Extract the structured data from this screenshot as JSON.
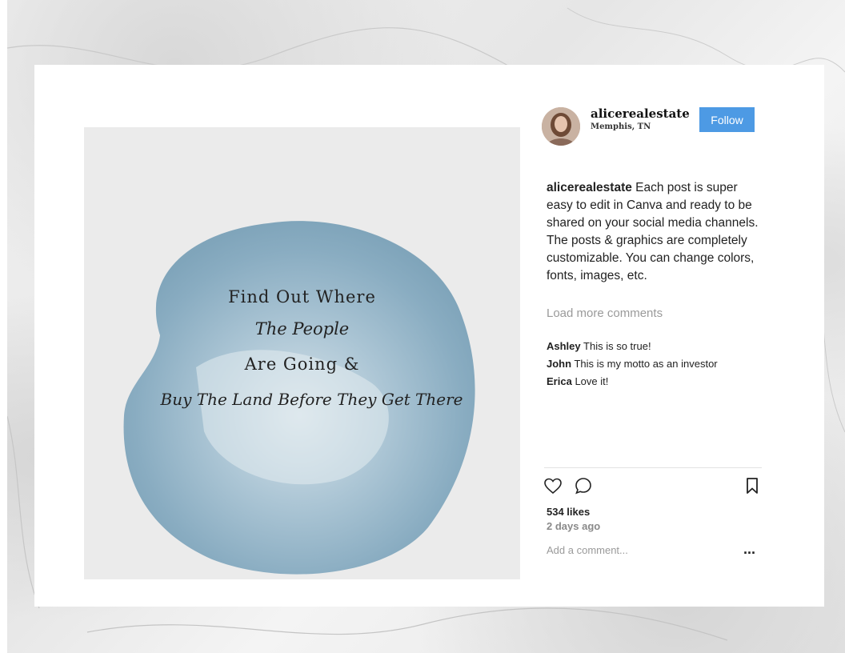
{
  "post": {
    "quote": {
      "line1": "Find Out Where",
      "line2": "The People",
      "line3": "Are Going &",
      "line4": "Buy The  Land Before They Get There"
    }
  },
  "profile": {
    "username": "alicerealestate",
    "location": "Memphis, TN",
    "follow_label": "Follow"
  },
  "caption": {
    "username": "alicerealestate",
    "text": "Each post is super easy to edit in Canva and ready to be shared on your social media channels. The posts & graphics are completely customizable. You can change colors, fonts, images, etc."
  },
  "comments": {
    "load_more_label": "Load more comments",
    "items": [
      {
        "user": "Ashley",
        "text": "This is so true!"
      },
      {
        "user": "John",
        "text": "This is my motto as an investor"
      },
      {
        "user": "Erica",
        "text": "Love it!"
      }
    ]
  },
  "stats": {
    "likes": "534 likes",
    "posted": "2 days ago"
  },
  "composer": {
    "placeholder": "Add a comment...",
    "more_label": "..."
  },
  "colors": {
    "follow_button": "#4d9ae4",
    "watercolor_blob": "#8fb3c8"
  }
}
